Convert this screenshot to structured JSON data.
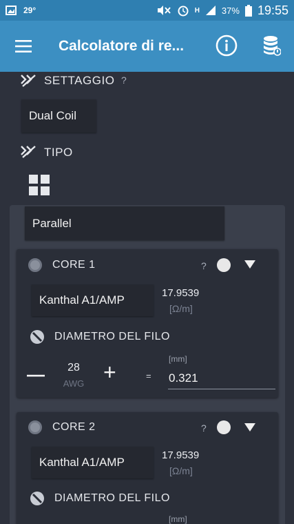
{
  "status_bar": {
    "temperature": "29°",
    "battery": "37%",
    "time": "19:55",
    "network": "H"
  },
  "app_bar": {
    "title": "Calcolatore di re..."
  },
  "settaggio": {
    "label": "SETTAGGIO",
    "help": "?",
    "value": "Dual Coil"
  },
  "tipo": {
    "label": "TIPO",
    "value": "Parallel"
  },
  "cores": [
    {
      "label": "CORE 1",
      "help": "?",
      "material": "Kanthal A1/AMP",
      "resistance": "17.9539",
      "resistance_unit": "[Ω/m]",
      "diameter_label": "DIAMETRO DEL FILO",
      "minus": "—",
      "plus": "+",
      "awg_value": "28",
      "awg_unit": "AWG",
      "equals": "=",
      "mm_unit": "[mm]",
      "diameter_value": "0.321"
    },
    {
      "label": "CORE 2",
      "help": "?",
      "material": "Kanthal A1/AMP",
      "resistance": "17.9539",
      "resistance_unit": "[Ω/m]",
      "diameter_label": "DIAMETRO DEL FILO",
      "mm_unit": "[mm]"
    }
  ]
}
